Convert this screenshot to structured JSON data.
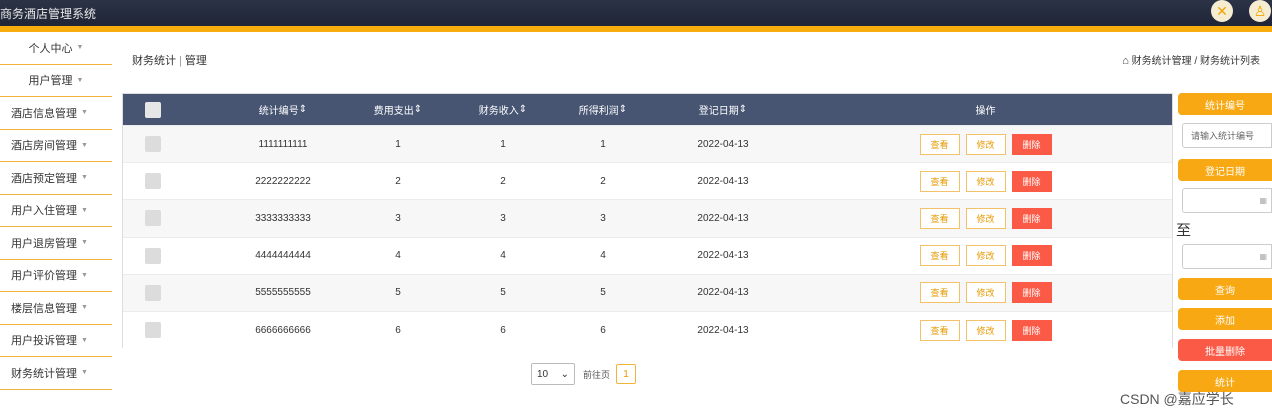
{
  "app": {
    "title": "商务酒店管理系统"
  },
  "header_icons": [
    "close-icon",
    "user-icon"
  ],
  "sidebar": {
    "items": [
      {
        "label": "个人中心"
      },
      {
        "label": "用户管理"
      },
      {
        "label": "酒店信息管理"
      },
      {
        "label": "酒店房间管理"
      },
      {
        "label": "酒店预定管理"
      },
      {
        "label": "用户入住管理"
      },
      {
        "label": "用户退房管理"
      },
      {
        "label": "用户评价管理"
      },
      {
        "label": "楼层信息管理"
      },
      {
        "label": "用户投诉管理"
      },
      {
        "label": "财务统计管理"
      }
    ]
  },
  "breadcrumb": {
    "left_first": "财务统计",
    "left_sep": "|",
    "left_second": "管理",
    "right": "财务统计管理 / 财务统计列表"
  },
  "table": {
    "headers": [
      "统计编号",
      "费用支出",
      "财务收入",
      "所得利润",
      "登记日期",
      "操作"
    ],
    "rows": [
      {
        "id": "1111111111",
        "expense": "1",
        "income": "1",
        "profit": "1",
        "date": "2022-04-13"
      },
      {
        "id": "2222222222",
        "expense": "2",
        "income": "2",
        "profit": "2",
        "date": "2022-04-13"
      },
      {
        "id": "3333333333",
        "expense": "3",
        "income": "3",
        "profit": "3",
        "date": "2022-04-13"
      },
      {
        "id": "4444444444",
        "expense": "4",
        "income": "4",
        "profit": "4",
        "date": "2022-04-13"
      },
      {
        "id": "5555555555",
        "expense": "5",
        "income": "5",
        "profit": "5",
        "date": "2022-04-13"
      },
      {
        "id": "6666666666",
        "expense": "6",
        "income": "6",
        "profit": "6",
        "date": "2022-04-13"
      }
    ],
    "actions": {
      "view": "查看",
      "edit": "修改",
      "delete": "删除"
    }
  },
  "pager": {
    "page_size": "10",
    "go_label": "前往页",
    "current_page": "1"
  },
  "search_panel": {
    "id_label": "统计编号",
    "id_placeholder": "请输入统计编号",
    "date_label": "登记日期",
    "range_sep": "至",
    "search_button": "查询",
    "add_button": "添加",
    "batch_delete_button": "批量删除",
    "stats_button": "统计"
  },
  "watermark": "CSDN @嘉应学长",
  "colors": {
    "accent": "#f7ad0e",
    "header": "#475573",
    "danger": "#fb5a47"
  }
}
